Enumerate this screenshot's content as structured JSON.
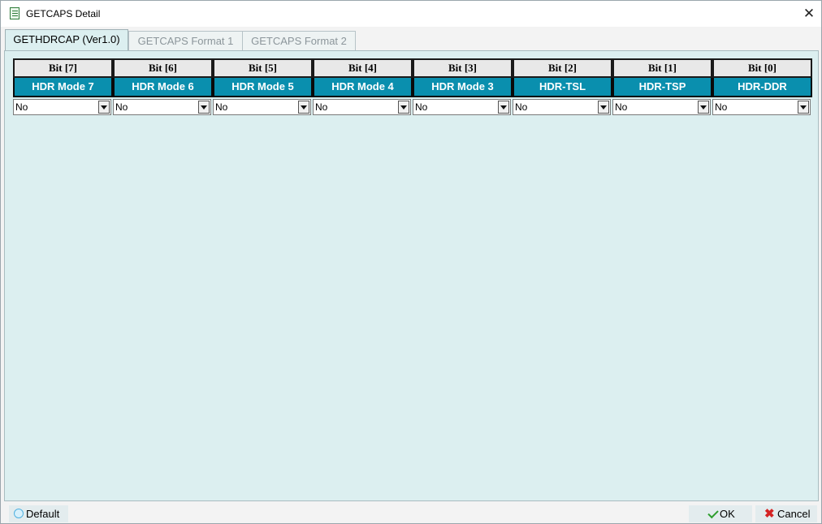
{
  "window": {
    "title": "GETCAPS Detail",
    "close_label": "✕"
  },
  "tabs": [
    {
      "label": "GETHDRCAP (Ver1.0)",
      "active": true
    },
    {
      "label": "GETCAPS Format 1",
      "active": false
    },
    {
      "label": "GETCAPS Format 2",
      "active": false
    }
  ],
  "columns": [
    {
      "bit": "Bit [7]",
      "name": "HDR Mode 7",
      "value": "No"
    },
    {
      "bit": "Bit [6]",
      "name": "HDR Mode 6",
      "value": "No"
    },
    {
      "bit": "Bit [5]",
      "name": "HDR Mode 5",
      "value": "No"
    },
    {
      "bit": "Bit [4]",
      "name": "HDR Mode 4",
      "value": "No"
    },
    {
      "bit": "Bit [3]",
      "name": "HDR Mode 3",
      "value": "No"
    },
    {
      "bit": "Bit [2]",
      "name": "HDR-TSL",
      "value": "No"
    },
    {
      "bit": "Bit [1]",
      "name": "HDR-TSP",
      "value": "No"
    },
    {
      "bit": "Bit [0]",
      "name": "HDR-DDR",
      "value": "No"
    }
  ],
  "footer": {
    "default_label": "Default",
    "ok_label": "OK",
    "cancel_label": "Cancel"
  },
  "colors": {
    "header_accent": "#0a8fae",
    "content_bg": "#dceff0"
  }
}
